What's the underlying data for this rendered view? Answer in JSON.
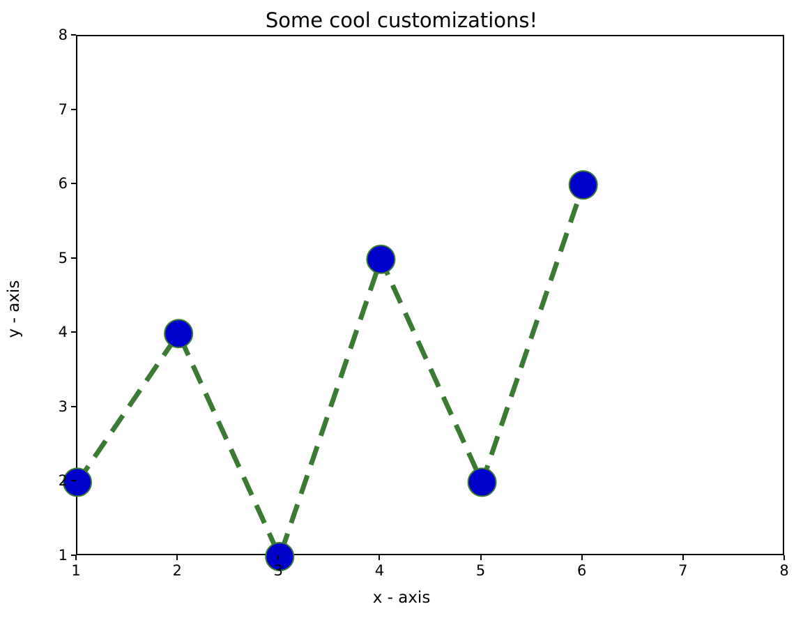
{
  "chart_data": {
    "type": "line",
    "title": "Some cool customizations!",
    "xlabel": "x - axis",
    "ylabel": "y - axis",
    "x": [
      1,
      2,
      3,
      4,
      5,
      6
    ],
    "y": [
      2,
      4,
      1,
      5,
      2,
      6
    ],
    "xlim": [
      1,
      8
    ],
    "ylim": [
      1,
      8
    ],
    "xticks": [
      1,
      2,
      3,
      4,
      5,
      6,
      7,
      8
    ],
    "yticks": [
      1,
      2,
      3,
      4,
      5,
      6,
      7,
      8
    ],
    "line_style": "dashed",
    "line_color": "#3a7a33",
    "marker_fill": "#0000cc",
    "marker_edge": "#3a7a33",
    "marker_size": 20
  }
}
